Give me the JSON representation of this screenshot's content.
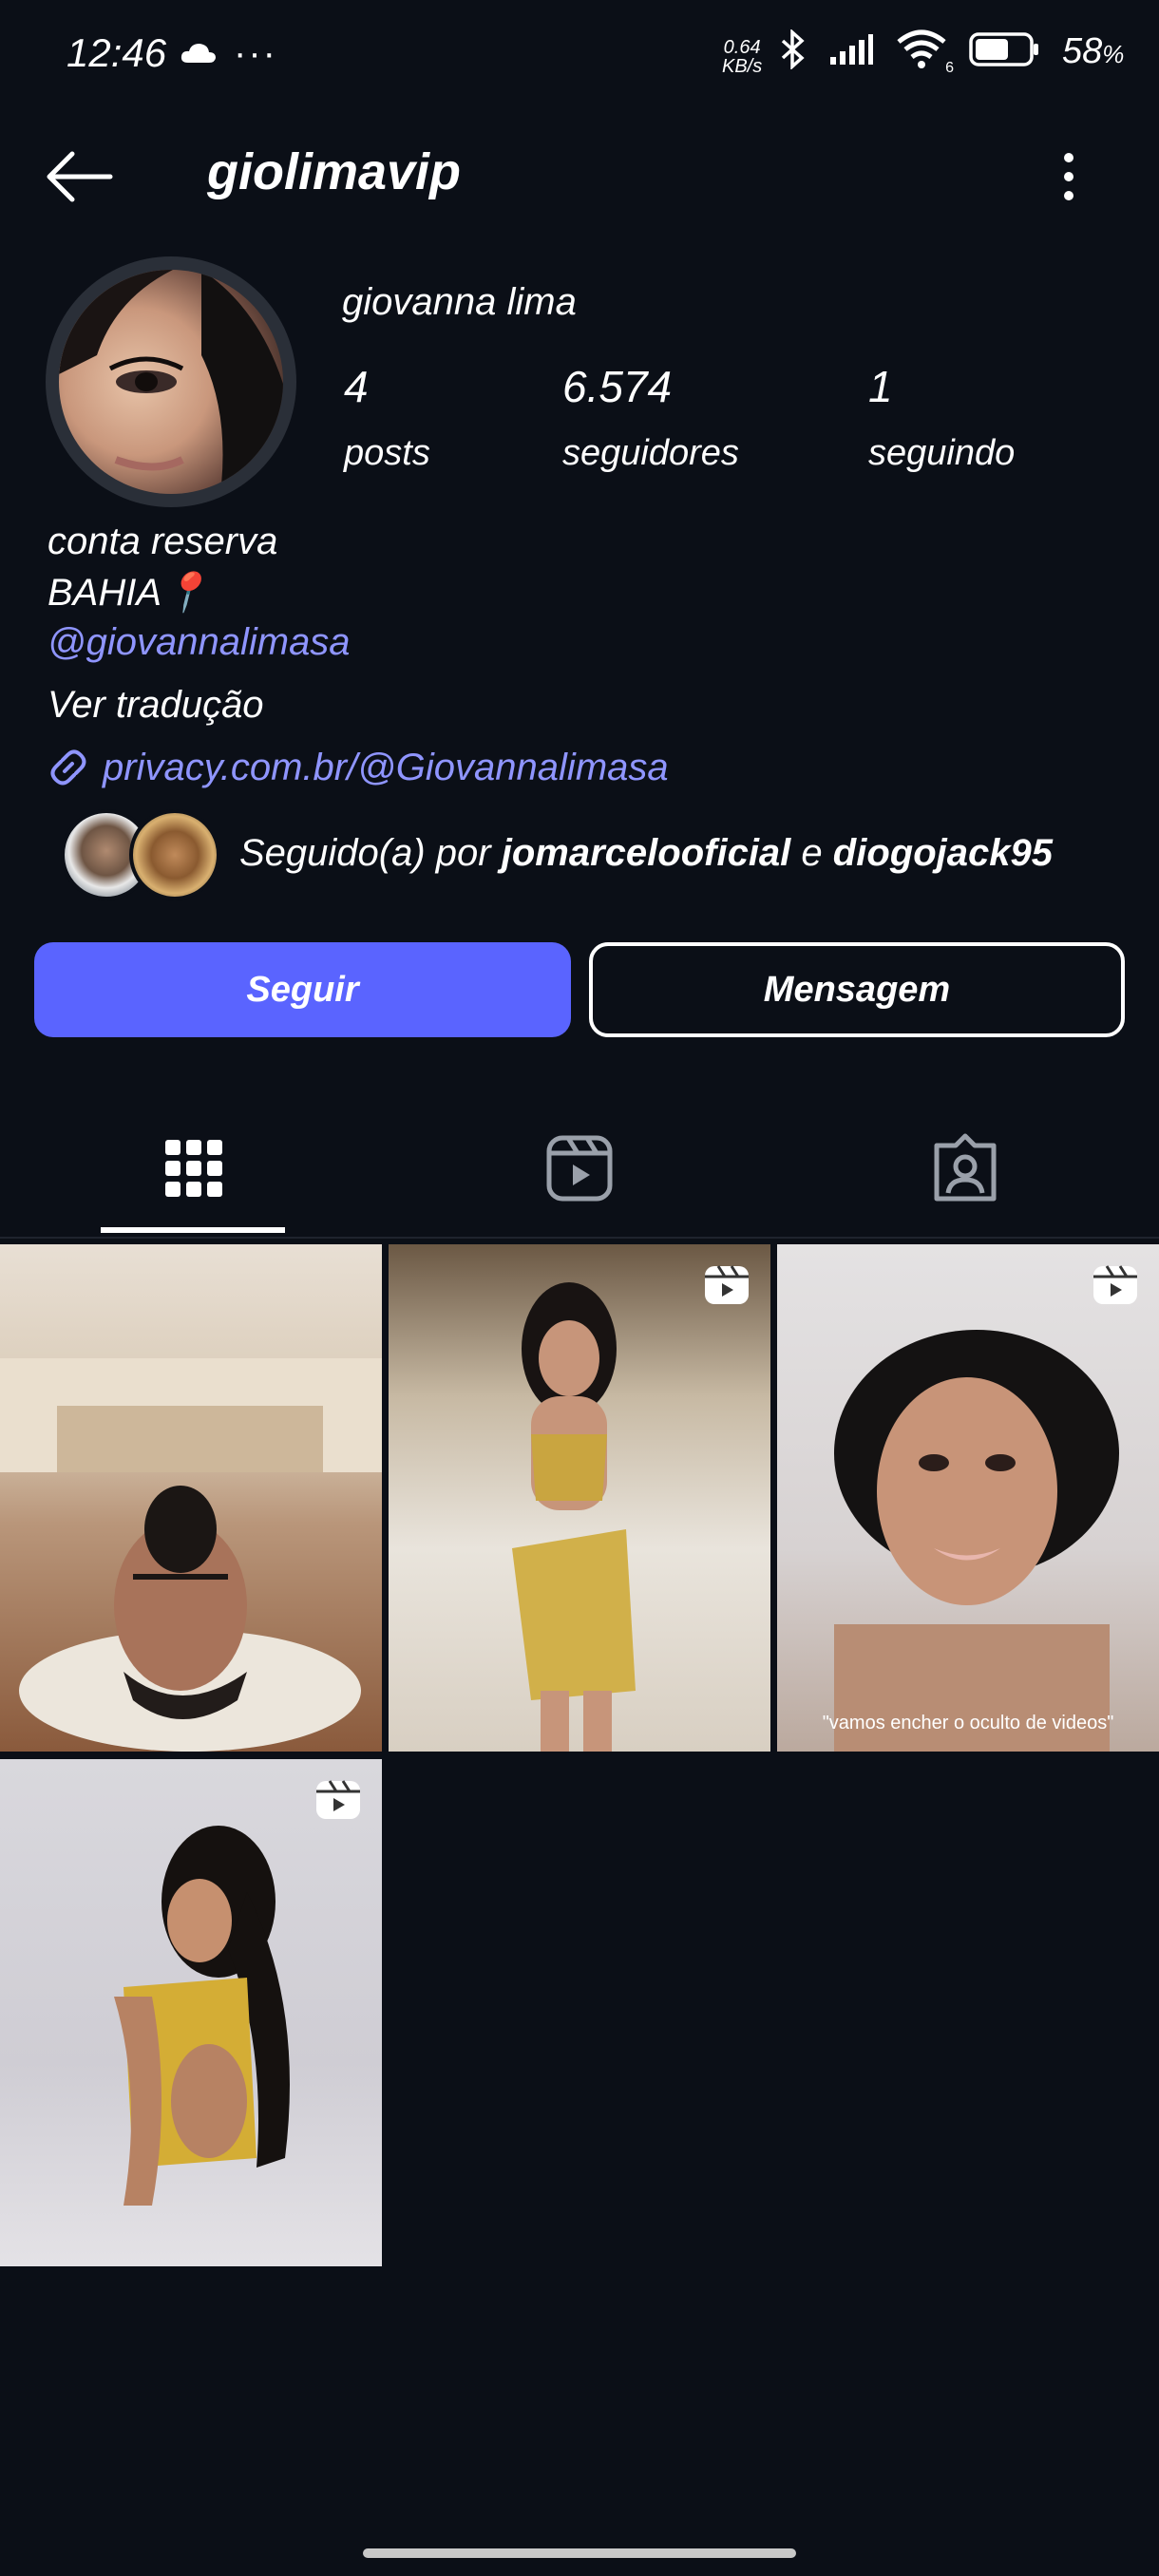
{
  "status_bar": {
    "time": "12:46",
    "dots": "···",
    "speed_value": "0.64",
    "speed_unit": "KB/s",
    "wifi_badge": "6",
    "battery": "58",
    "battery_unit": "%"
  },
  "header": {
    "username": "giolimavip"
  },
  "profile": {
    "display_name": "giovanna lima",
    "stats": [
      {
        "value": "4",
        "label": "posts"
      },
      {
        "value": "6.574",
        "label": "seguidores"
      },
      {
        "value": "1",
        "label": "seguindo"
      }
    ],
    "bio_lines": [
      "conta reserva",
      "BAHIA📍"
    ],
    "mention": "@giovannalimasa",
    "translate": "Ver tradução",
    "link": "privacy.com.br/@Giovannalimasa",
    "followed_by_prefix": "Seguido(a) por",
    "followed_by_user1": "jomarcelooficial",
    "followed_by_join": "e",
    "followed_by_user2": "diogojack95"
  },
  "actions": {
    "follow": "Seguir",
    "message": "Mensagem"
  },
  "tabs": {
    "active": "grid"
  },
  "grid": {
    "tiles": [
      {
        "kind": "photo"
      },
      {
        "kind": "reel"
      },
      {
        "kind": "reel",
        "caption": "\"vamos encher o oculto de videos\""
      },
      {
        "kind": "reel"
      }
    ]
  },
  "colors": {
    "background": "#0b0f17",
    "accent": "#5a64ff",
    "link": "#8f95ff"
  }
}
